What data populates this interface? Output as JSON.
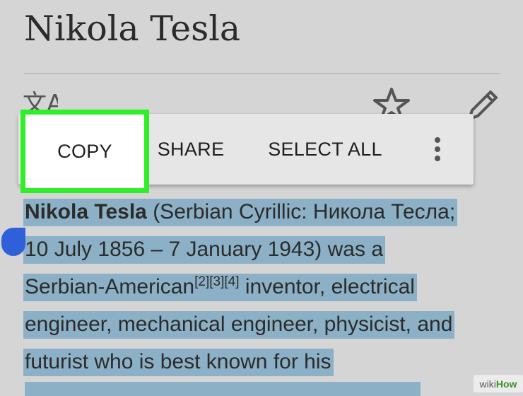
{
  "header": {
    "title": "Nikola Tesla"
  },
  "toolbar": {
    "icons": [
      "language-icon",
      "star-icon",
      "pencil-icon"
    ]
  },
  "context_menu": {
    "copy": "COPY",
    "share": "SHARE",
    "select_all": "SELECT ALL",
    "more_icon": "more-vert-icon"
  },
  "highlight_color": "#2ef027",
  "selection_color": "#8cb0c6",
  "article": {
    "lead": "Nikola Tesla",
    "line1_rest": " (Serbian Cyrillic: Никола Тесла;",
    "line2": "10 July 1856 – 7 January 1943) was a",
    "line3_start": "Serbian-American",
    "citation": "[2][3][4]",
    "line3_end": " inventor, electrical",
    "line4": "engineer, mechanical engineer, physicist, and",
    "line5": "futurist who is best known for his"
  },
  "watermark": {
    "wiki": "wiki",
    "how": "How"
  }
}
